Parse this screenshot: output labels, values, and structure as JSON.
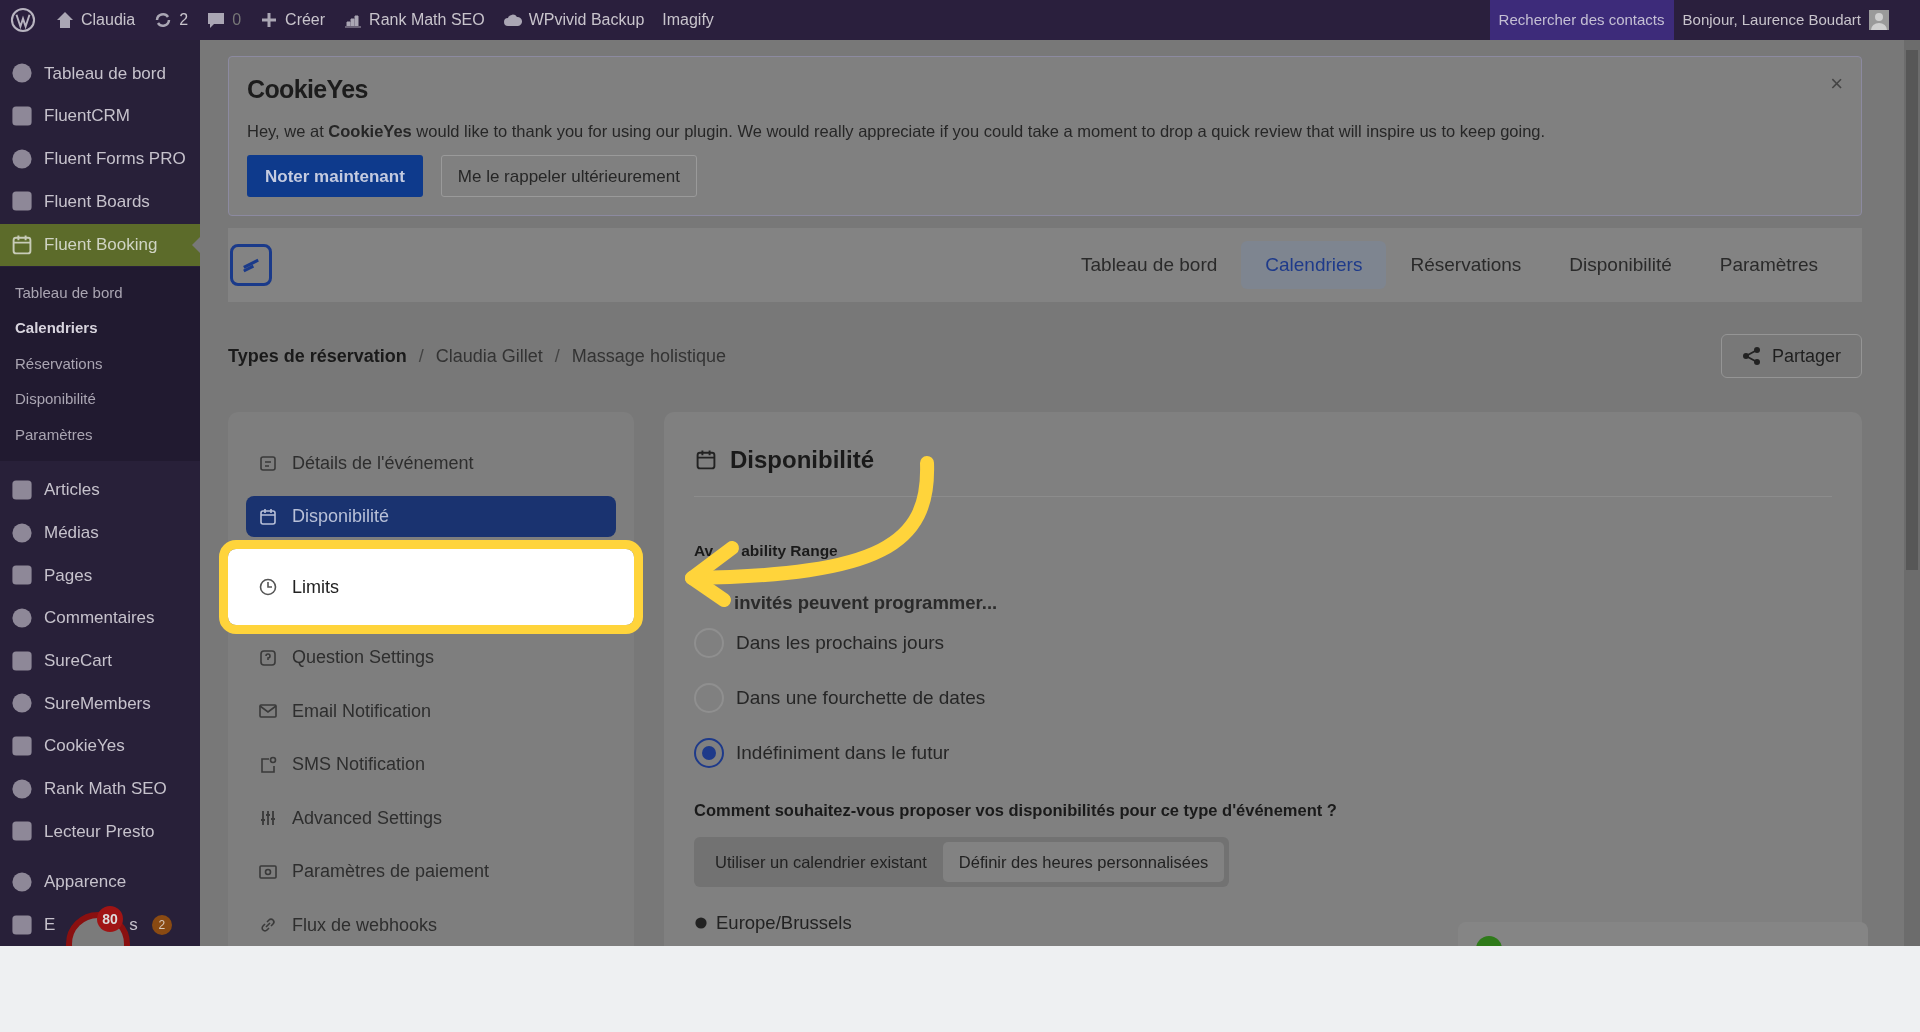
{
  "admin_bar": {
    "items": [
      {
        "label": "Claudia"
      },
      {
        "label": "2"
      },
      {
        "label": "0"
      },
      {
        "label": "Créer"
      },
      {
        "label": "Rank Math SEO"
      },
      {
        "label": "WPvivid Backup"
      },
      {
        "label": "Imagify"
      }
    ],
    "search": "Rechercher des contacts",
    "greeting": "Bonjour, Laurence Boudart"
  },
  "sidebar": {
    "items": [
      {
        "label": "Tableau de bord",
        "selected": false
      },
      {
        "label": "FluentCRM",
        "selected": false
      },
      {
        "label": "Fluent Forms PRO",
        "selected": false
      },
      {
        "label": "Fluent Boards",
        "selected": false
      },
      {
        "label": "Fluent Booking",
        "selected": true,
        "children": [
          {
            "label": "Tableau de bord",
            "selected": false
          },
          {
            "label": "Calendriers",
            "selected": true
          },
          {
            "label": "Réservations",
            "selected": false
          },
          {
            "label": "Disponibilité",
            "selected": false
          },
          {
            "label": "Paramètres",
            "selected": false
          }
        ]
      },
      {
        "label": "Articles",
        "selected": false
      },
      {
        "label": "Médias",
        "selected": false
      },
      {
        "label": "Pages",
        "selected": false
      },
      {
        "label": "Commentaires",
        "selected": false
      },
      {
        "label": "SureCart",
        "selected": false
      },
      {
        "label": "SureMembers",
        "selected": false
      },
      {
        "label": "CookieYes",
        "selected": false
      },
      {
        "label": "Rank Math SEO",
        "selected": false
      },
      {
        "label": "Lecteur Presto",
        "selected": false
      },
      {
        "label": "Apparence",
        "selected": false
      },
      {
        "label": "E",
        "label_tail": "s",
        "selected": false,
        "badge": "2"
      }
    ]
  },
  "chat_bubble": {
    "badge": "80"
  },
  "notice": {
    "brand": "CookieYes",
    "message": "Hey, we at **CookieYes** would like to thank you for using our plugin. We would really appreciate if you could take a moment to drop a quick review that will inspire us to keep going.",
    "buttons": [
      "Noter maintenant",
      "Me le rappeler ultérieurement"
    ],
    "close": "×"
  },
  "nav": {
    "tabs": [
      {
        "label": "Tableau de bord",
        "selected": false
      },
      {
        "label": "Calendriers",
        "selected": true
      },
      {
        "label": "Réservations",
        "selected": false
      },
      {
        "label": "Disponibilité",
        "selected": false
      },
      {
        "label": "Paramètres",
        "selected": false
      }
    ]
  },
  "breadcrumb": [
    {
      "label": "Types de réservation"
    },
    {
      "separator": "/",
      "label": "Claudia Gillet"
    },
    {
      "separator": "/",
      "label": "Massage holistique"
    }
  ],
  "share_button": "Partager",
  "settings_menu": [
    {
      "label": "Détails de l'événement",
      "selected": false,
      "highlighted": false
    },
    {
      "label": "Disponibilité",
      "selected": true,
      "highlighted": false
    },
    {
      "label": "Limits",
      "selected": false,
      "highlighted": true
    },
    {
      "label": "Question Settings",
      "selected": false,
      "highlighted": false
    },
    {
      "label": "Email Notification",
      "selected": false,
      "highlighted": false
    },
    {
      "label": "SMS Notification",
      "selected": false,
      "highlighted": false
    },
    {
      "label": "Advanced Settings",
      "selected": false,
      "highlighted": false
    },
    {
      "label": "Paramètres de paiement",
      "selected": false,
      "highlighted": false
    },
    {
      "label": "Flux de webhooks",
      "selected": false,
      "highlighted": false
    }
  ],
  "panel": {
    "title": "Disponibilité",
    "range_label": [
      "Av",
      "ability Range"
    ],
    "range_hint": "invités peuvent programmer...",
    "range_options": [
      {
        "label": "Dans les prochains jours",
        "selected": false
      },
      {
        "label": "Dans une fourchette de dates",
        "selected": false
      },
      {
        "label": "Indéfiniment dans le futur",
        "selected": true
      }
    ],
    "question": "Comment souhaitez-vous proposer vos disponibilités pour ce type d'événement ?",
    "modes": [
      {
        "label": "Utiliser un calendrier existant",
        "selected": false
      },
      {
        "label": "Définir des heures personnalisées",
        "selected": true
      }
    ],
    "timezone": "Europe/Brussels"
  }
}
